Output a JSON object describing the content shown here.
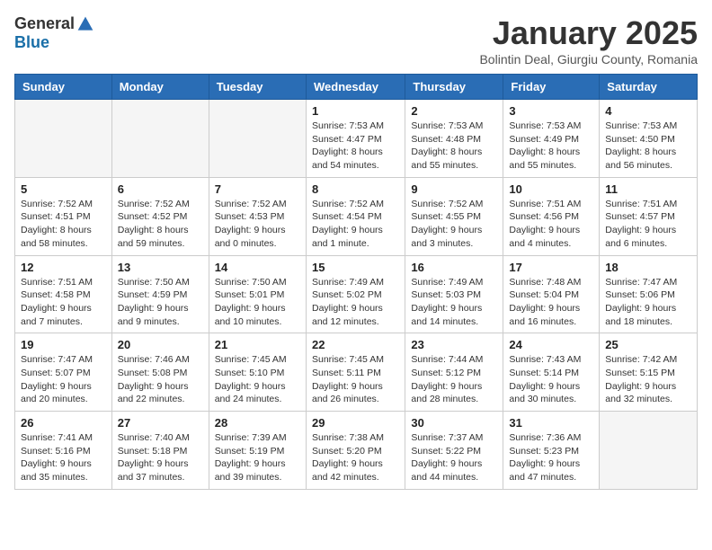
{
  "logo": {
    "general": "General",
    "blue": "Blue"
  },
  "title": "January 2025",
  "location": "Bolintin Deal, Giurgiu County, Romania",
  "days_header": [
    "Sunday",
    "Monday",
    "Tuesday",
    "Wednesday",
    "Thursday",
    "Friday",
    "Saturday"
  ],
  "weeks": [
    [
      {
        "day": "",
        "info": ""
      },
      {
        "day": "",
        "info": ""
      },
      {
        "day": "",
        "info": ""
      },
      {
        "day": "1",
        "info": "Sunrise: 7:53 AM\nSunset: 4:47 PM\nDaylight: 8 hours and 54 minutes."
      },
      {
        "day": "2",
        "info": "Sunrise: 7:53 AM\nSunset: 4:48 PM\nDaylight: 8 hours and 55 minutes."
      },
      {
        "day": "3",
        "info": "Sunrise: 7:53 AM\nSunset: 4:49 PM\nDaylight: 8 hours and 55 minutes."
      },
      {
        "day": "4",
        "info": "Sunrise: 7:53 AM\nSunset: 4:50 PM\nDaylight: 8 hours and 56 minutes."
      }
    ],
    [
      {
        "day": "5",
        "info": "Sunrise: 7:52 AM\nSunset: 4:51 PM\nDaylight: 8 hours and 58 minutes."
      },
      {
        "day": "6",
        "info": "Sunrise: 7:52 AM\nSunset: 4:52 PM\nDaylight: 8 hours and 59 minutes."
      },
      {
        "day": "7",
        "info": "Sunrise: 7:52 AM\nSunset: 4:53 PM\nDaylight: 9 hours and 0 minutes."
      },
      {
        "day": "8",
        "info": "Sunrise: 7:52 AM\nSunset: 4:54 PM\nDaylight: 9 hours and 1 minute."
      },
      {
        "day": "9",
        "info": "Sunrise: 7:52 AM\nSunset: 4:55 PM\nDaylight: 9 hours and 3 minutes."
      },
      {
        "day": "10",
        "info": "Sunrise: 7:51 AM\nSunset: 4:56 PM\nDaylight: 9 hours and 4 minutes."
      },
      {
        "day": "11",
        "info": "Sunrise: 7:51 AM\nSunset: 4:57 PM\nDaylight: 9 hours and 6 minutes."
      }
    ],
    [
      {
        "day": "12",
        "info": "Sunrise: 7:51 AM\nSunset: 4:58 PM\nDaylight: 9 hours and 7 minutes."
      },
      {
        "day": "13",
        "info": "Sunrise: 7:50 AM\nSunset: 4:59 PM\nDaylight: 9 hours and 9 minutes."
      },
      {
        "day": "14",
        "info": "Sunrise: 7:50 AM\nSunset: 5:01 PM\nDaylight: 9 hours and 10 minutes."
      },
      {
        "day": "15",
        "info": "Sunrise: 7:49 AM\nSunset: 5:02 PM\nDaylight: 9 hours and 12 minutes."
      },
      {
        "day": "16",
        "info": "Sunrise: 7:49 AM\nSunset: 5:03 PM\nDaylight: 9 hours and 14 minutes."
      },
      {
        "day": "17",
        "info": "Sunrise: 7:48 AM\nSunset: 5:04 PM\nDaylight: 9 hours and 16 minutes."
      },
      {
        "day": "18",
        "info": "Sunrise: 7:47 AM\nSunset: 5:06 PM\nDaylight: 9 hours and 18 minutes."
      }
    ],
    [
      {
        "day": "19",
        "info": "Sunrise: 7:47 AM\nSunset: 5:07 PM\nDaylight: 9 hours and 20 minutes."
      },
      {
        "day": "20",
        "info": "Sunrise: 7:46 AM\nSunset: 5:08 PM\nDaylight: 9 hours and 22 minutes."
      },
      {
        "day": "21",
        "info": "Sunrise: 7:45 AM\nSunset: 5:10 PM\nDaylight: 9 hours and 24 minutes."
      },
      {
        "day": "22",
        "info": "Sunrise: 7:45 AM\nSunset: 5:11 PM\nDaylight: 9 hours and 26 minutes."
      },
      {
        "day": "23",
        "info": "Sunrise: 7:44 AM\nSunset: 5:12 PM\nDaylight: 9 hours and 28 minutes."
      },
      {
        "day": "24",
        "info": "Sunrise: 7:43 AM\nSunset: 5:14 PM\nDaylight: 9 hours and 30 minutes."
      },
      {
        "day": "25",
        "info": "Sunrise: 7:42 AM\nSunset: 5:15 PM\nDaylight: 9 hours and 32 minutes."
      }
    ],
    [
      {
        "day": "26",
        "info": "Sunrise: 7:41 AM\nSunset: 5:16 PM\nDaylight: 9 hours and 35 minutes."
      },
      {
        "day": "27",
        "info": "Sunrise: 7:40 AM\nSunset: 5:18 PM\nDaylight: 9 hours and 37 minutes."
      },
      {
        "day": "28",
        "info": "Sunrise: 7:39 AM\nSunset: 5:19 PM\nDaylight: 9 hours and 39 minutes."
      },
      {
        "day": "29",
        "info": "Sunrise: 7:38 AM\nSunset: 5:20 PM\nDaylight: 9 hours and 42 minutes."
      },
      {
        "day": "30",
        "info": "Sunrise: 7:37 AM\nSunset: 5:22 PM\nDaylight: 9 hours and 44 minutes."
      },
      {
        "day": "31",
        "info": "Sunrise: 7:36 AM\nSunset: 5:23 PM\nDaylight: 9 hours and 47 minutes."
      },
      {
        "day": "",
        "info": ""
      }
    ]
  ]
}
